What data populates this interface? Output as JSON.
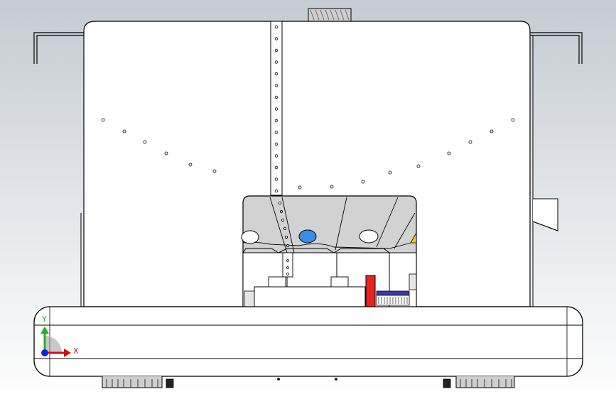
{
  "viewport": {
    "background_top": "#c5cbd3",
    "background_bottom": "#ffffff"
  },
  "triad": {
    "x_label": "X",
    "y_label": "Y",
    "x_color": "#d01010",
    "y_color": "#20b020",
    "z_color": "#1020e0"
  },
  "model": {
    "part_color": "#ffffff",
    "cavity_color": "#d2d2d2",
    "edge_color": "#000000",
    "accent_red": "#e8231e",
    "accent_blue": "#3b8ee8",
    "accent_yellow": "#f2cc2a",
    "connector_blue": "#3a3ab0"
  }
}
